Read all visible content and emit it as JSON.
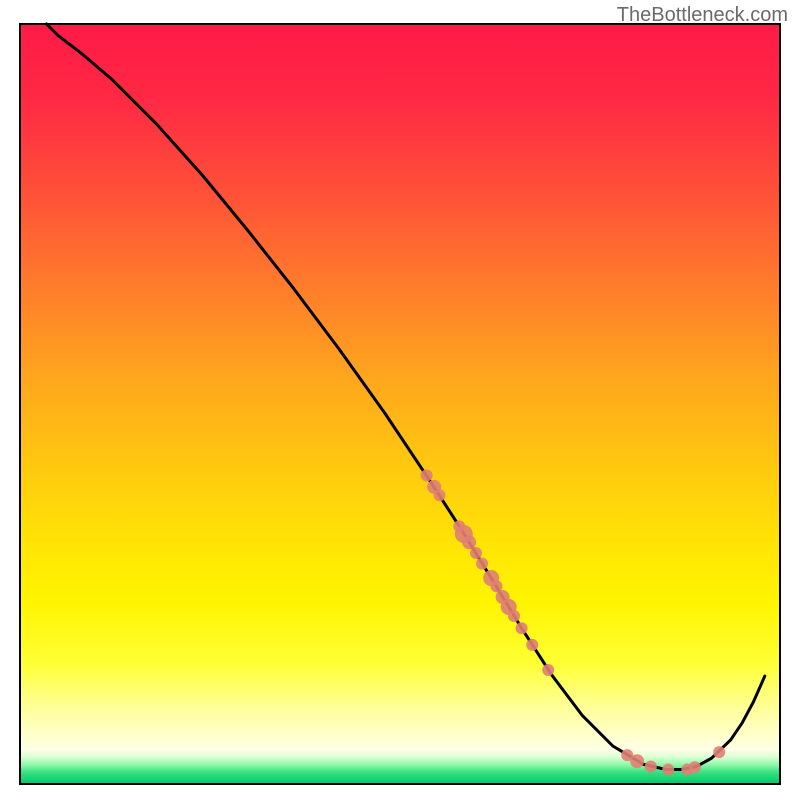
{
  "watermark": "TheBottleneck.com",
  "chart_data": {
    "type": "line",
    "title": "",
    "xlabel": "",
    "ylabel": "",
    "xlim": [
      0,
      100
    ],
    "ylim": [
      0,
      100
    ],
    "curve": {
      "x": [
        3.5,
        5,
        8,
        12,
        18,
        24,
        30,
        36,
        42,
        48,
        54,
        58,
        62,
        66,
        70,
        74,
        78,
        82,
        85,
        87,
        89,
        91,
        93.5,
        95,
        96.5,
        98
      ],
      "y": [
        100,
        98.5,
        96.2,
        92.8,
        86.8,
        80.1,
        72.8,
        65.2,
        57.2,
        48.8,
        39.8,
        33.6,
        27.1,
        20.5,
        14.3,
        9.0,
        5.0,
        2.6,
        1.9,
        1.9,
        2.3,
        3.4,
        5.8,
        8.0,
        10.8,
        14.2
      ]
    },
    "scatter_points": [
      {
        "x": 53.5,
        "y": 40.6,
        "r": 6
      },
      {
        "x": 54.5,
        "y": 39.1,
        "r": 7
      },
      {
        "x": 55.2,
        "y": 38.0,
        "r": 6
      },
      {
        "x": 57.8,
        "y": 33.9,
        "r": 6
      },
      {
        "x": 58.4,
        "y": 32.9,
        "r": 9
      },
      {
        "x": 59.1,
        "y": 31.8,
        "r": 7
      },
      {
        "x": 60.0,
        "y": 30.4,
        "r": 6
      },
      {
        "x": 60.8,
        "y": 29.0,
        "r": 6
      },
      {
        "x": 62.0,
        "y": 27.1,
        "r": 8
      },
      {
        "x": 62.7,
        "y": 26.0,
        "r": 6
      },
      {
        "x": 63.5,
        "y": 24.6,
        "r": 7
      },
      {
        "x": 64.3,
        "y": 23.3,
        "r": 8
      },
      {
        "x": 65.0,
        "y": 22.1,
        "r": 6
      },
      {
        "x": 66.0,
        "y": 20.5,
        "r": 6
      },
      {
        "x": 67.4,
        "y": 18.3,
        "r": 6
      },
      {
        "x": 69.5,
        "y": 15.0,
        "r": 6
      },
      {
        "x": 79.9,
        "y": 3.8,
        "r": 6
      },
      {
        "x": 81.2,
        "y": 3.0,
        "r": 7
      },
      {
        "x": 83.0,
        "y": 2.3,
        "r": 6
      },
      {
        "x": 85.3,
        "y": 1.9,
        "r": 6
      },
      {
        "x": 87.8,
        "y": 1.9,
        "r": 6
      },
      {
        "x": 88.8,
        "y": 2.2,
        "r": 6
      },
      {
        "x": 92.0,
        "y": 4.2,
        "r": 6
      }
    ],
    "gradient_stops": [
      {
        "offset": 0.0,
        "color": "#ff1a46"
      },
      {
        "offset": 0.1,
        "color": "#ff2944"
      },
      {
        "offset": 0.22,
        "color": "#ff5038"
      },
      {
        "offset": 0.34,
        "color": "#ff7a2c"
      },
      {
        "offset": 0.46,
        "color": "#ffa41e"
      },
      {
        "offset": 0.58,
        "color": "#ffc80f"
      },
      {
        "offset": 0.68,
        "color": "#ffe305"
      },
      {
        "offset": 0.76,
        "color": "#fff400"
      },
      {
        "offset": 0.84,
        "color": "#ffff33"
      },
      {
        "offset": 0.9,
        "color": "#ffff9a"
      },
      {
        "offset": 0.955,
        "color": "#ffffe6"
      },
      {
        "offset": 0.965,
        "color": "#d8ffd4"
      },
      {
        "offset": 0.975,
        "color": "#8cf7a6"
      },
      {
        "offset": 0.985,
        "color": "#33e07f"
      },
      {
        "offset": 1.0,
        "color": "#00c86a"
      }
    ],
    "colors": {
      "curve_stroke": "#000000",
      "point_fill": "#e07f73",
      "frame_stroke": "#000000"
    }
  }
}
